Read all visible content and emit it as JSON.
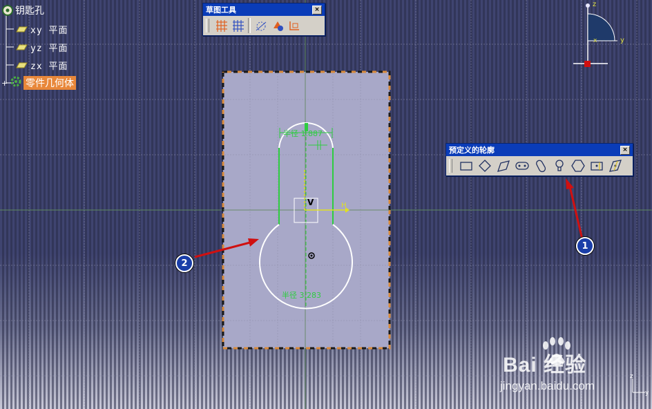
{
  "tree": {
    "root": "钥匙孔",
    "planes": [
      "xy 平面",
      "yz 平面",
      "zx 平面"
    ],
    "body": "零件几何体"
  },
  "toolbar_sketch": {
    "title": "草图工具",
    "close": "×",
    "buttons": [
      "grid-icon",
      "snap-grid-icon",
      "construction-icon",
      "geometric-constraint-icon",
      "dimension-constraint-icon"
    ]
  },
  "toolbar_profiles": {
    "title": "预定义的轮廓",
    "close": "×",
    "buttons": [
      "rectangle-icon",
      "oriented-rectangle-icon",
      "parallelogram-icon",
      "elongated-hole-icon",
      "cylindrical-elongated-hole-icon",
      "keyhole-profile-icon",
      "hexagon-icon",
      "centered-rectangle-icon",
      "centered-parallelogram-icon"
    ]
  },
  "sketch": {
    "top_dim": "半径 1.887",
    "bottom_dim": "半径 3.283",
    "v_label": "V",
    "h_label": "H"
  },
  "compass": {
    "z": "z",
    "y": "y",
    "x": "x"
  },
  "corner_axes": {
    "z": "z",
    "y": "y"
  },
  "badges": {
    "one": "1",
    "two": "2"
  },
  "watermark": {
    "logo": "Bai  经验",
    "url": "jingyan.baidu.com"
  },
  "colors": {
    "sel": "#e8873a",
    "accent_green": "#2ecc40",
    "arrow_red": "#d01010",
    "frame_orange": "#d98a3a"
  }
}
